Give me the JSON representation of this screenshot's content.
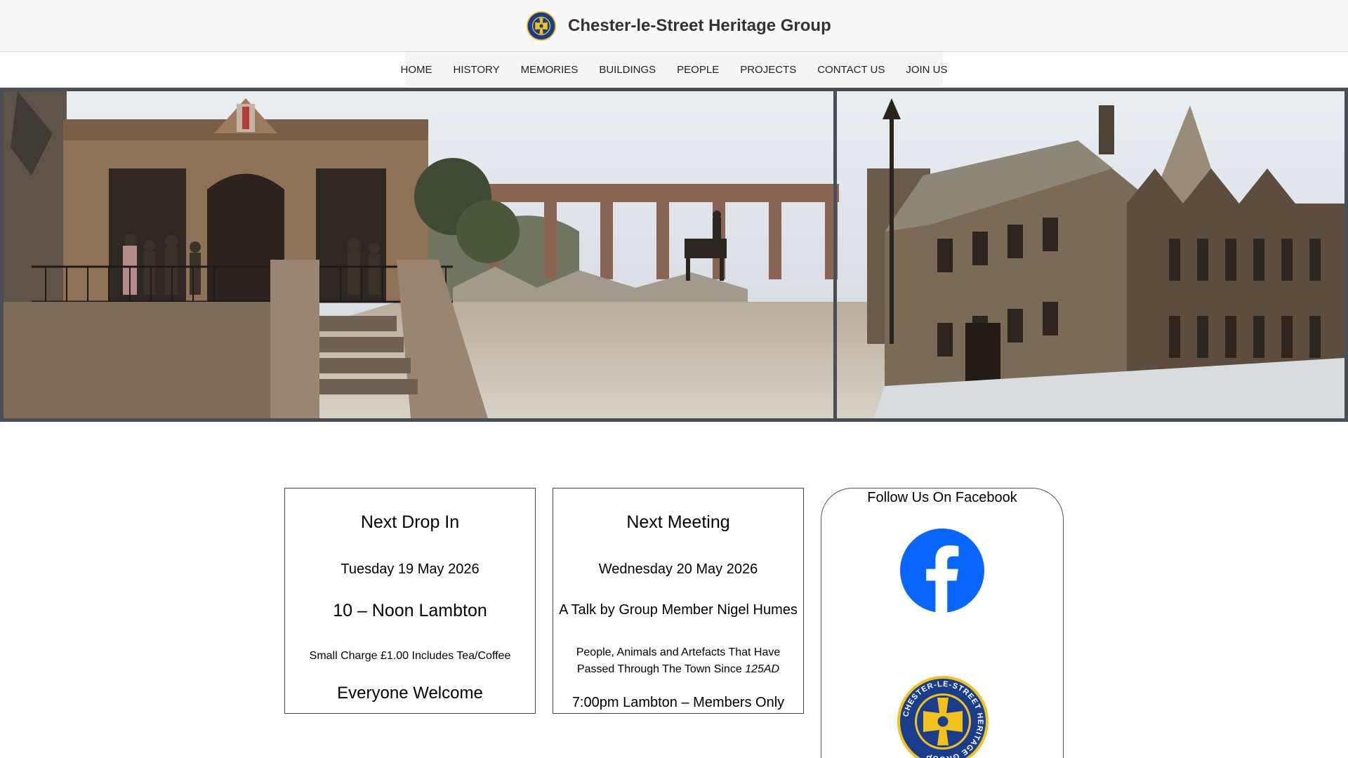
{
  "header": {
    "site_title": "Chester-le-Street Heritage Group",
    "logo_icon": "heritage-group-emblem-icon",
    "logo_ring_text": "CHESTER-LE-STREET HERITAGE GROUP"
  },
  "nav": {
    "items": [
      {
        "label": "HOME"
      },
      {
        "label": "HISTORY"
      },
      {
        "label": "MEMORIES"
      },
      {
        "label": "BUILDINGS"
      },
      {
        "label": "PEOPLE"
      },
      {
        "label": "PROJECTS"
      },
      {
        "label": "CONTACT US"
      },
      {
        "label": "JOIN US"
      }
    ]
  },
  "drop_in": {
    "heading": "Next Drop In",
    "date": "Tuesday 19 May 2026",
    "time_place": "10 – Noon Lambton",
    "charge": "Small Charge £1.00 Includes Tea/Coffee",
    "welcome": "Everyone Welcome"
  },
  "meeting": {
    "heading": "Next Meeting",
    "date": "Wednesday 20 May 2026",
    "talk": "A Talk by Group Member Nigel Humes",
    "topic_line1": "People, Animals and Artefacts That Have",
    "topic_line2": "Passed Through The Town Since ",
    "topic_year": "125AD",
    "time_place": "7:00pm Lambton – Members Only"
  },
  "facebook": {
    "title": "Follow Us On Facebook",
    "icon": "facebook-icon",
    "logo_icon": "heritage-group-emblem-icon"
  },
  "colors": {
    "header_bg": "#f8f8f8",
    "nav_bg": "#f5f5f5",
    "facebook_blue": "#0866ff",
    "emblem_blue": "#1a3c8c",
    "emblem_gold": "#f2c21b"
  }
}
